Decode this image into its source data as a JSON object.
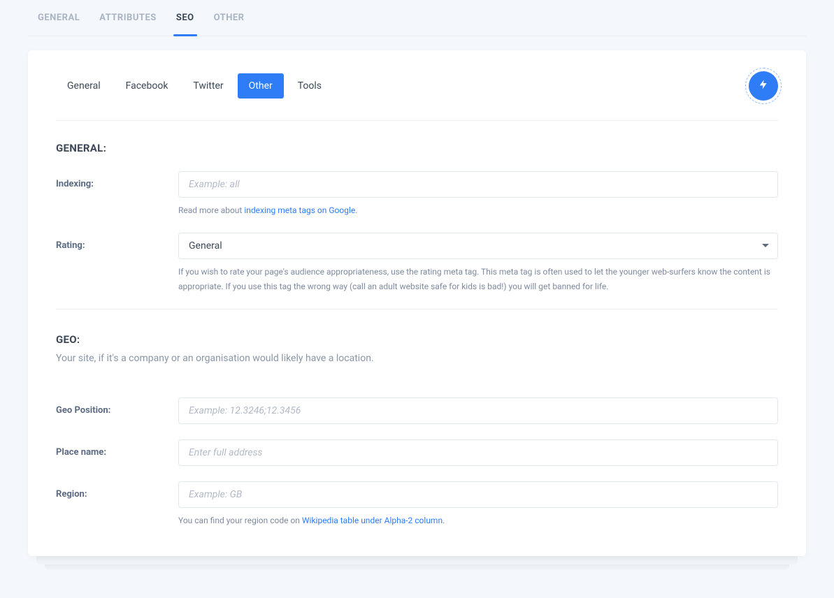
{
  "top_tabs": {
    "general": "GENERAL",
    "attributes": "ATTRIBUTES",
    "seo": "SEO",
    "other": "OTHER"
  },
  "sub_tabs": {
    "general": "General",
    "facebook": "Facebook",
    "twitter": "Twitter",
    "other": "Other",
    "tools": "Tools"
  },
  "sections": {
    "general": {
      "title": "GENERAL:",
      "indexing": {
        "label": "Indexing:",
        "placeholder": "Example: all",
        "help_prefix": "Read more about ",
        "help_link": "indexing meta tags on Google",
        "help_suffix": "."
      },
      "rating": {
        "label": "Rating:",
        "value": "General",
        "help": "If you wish to rate your page's audience appropriateness, use the rating meta tag. This meta tag is often used to let the younger web-surfers know the content is appropriate. If you use this tag the wrong way (call an adult website safe for kids is bad!) you will get banned for life."
      }
    },
    "geo": {
      "title": "GEO:",
      "desc": "Your site, if it's a company or an organisation would likely have a location.",
      "position": {
        "label": "Geo Position:",
        "placeholder": "Example: 12.3246;12.3456"
      },
      "placename": {
        "label": "Place name:",
        "placeholder": "Enter full address"
      },
      "region": {
        "label": "Region:",
        "placeholder": "Example: GB",
        "help_prefix": "You can find your region code on ",
        "help_link": "Wikipedia table under Alpha-2 column",
        "help_suffix": "."
      }
    }
  }
}
